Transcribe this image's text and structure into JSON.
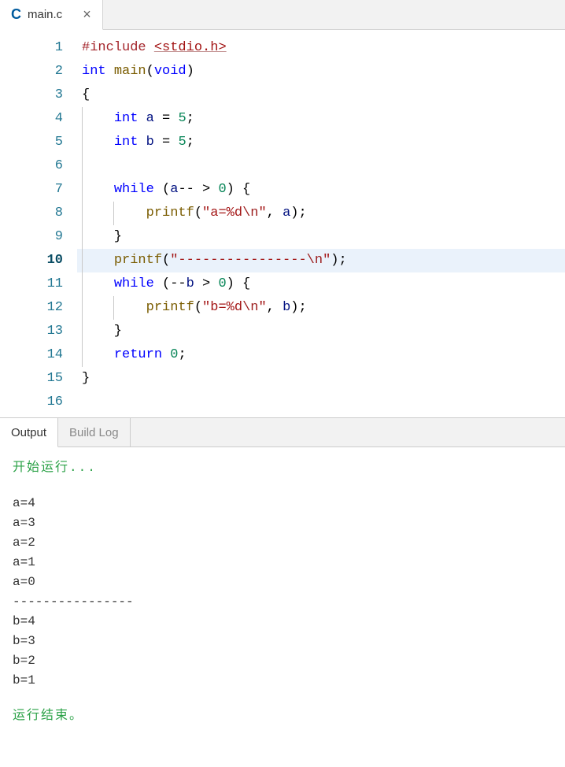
{
  "file_tab": {
    "icon": "C",
    "filename": "main.c",
    "close": "×"
  },
  "editor": {
    "current_line": 10,
    "lines": [
      {
        "num": 1,
        "tokens": [
          [
            "pp",
            "#include "
          ],
          [
            "inc",
            "<stdio.h>"
          ]
        ]
      },
      {
        "num": 2,
        "tokens": [
          [
            "type",
            "int"
          ],
          [
            "punct",
            " "
          ],
          [
            "fn",
            "main"
          ],
          [
            "punct",
            "("
          ],
          [
            "type",
            "void"
          ],
          [
            "punct",
            ")"
          ]
        ]
      },
      {
        "num": 3,
        "tokens": [
          [
            "punct",
            "{"
          ]
        ]
      },
      {
        "num": 4,
        "indent": 1,
        "tokens": [
          [
            "punct",
            "    "
          ],
          [
            "type",
            "int"
          ],
          [
            "punct",
            " "
          ],
          [
            "var",
            "a"
          ],
          [
            "punct",
            " "
          ],
          [
            "op",
            "="
          ],
          [
            "punct",
            " "
          ],
          [
            "num",
            "5"
          ],
          [
            "punct",
            ";"
          ]
        ]
      },
      {
        "num": 5,
        "indent": 1,
        "tokens": [
          [
            "punct",
            "    "
          ],
          [
            "type",
            "int"
          ],
          [
            "punct",
            " "
          ],
          [
            "var",
            "b"
          ],
          [
            "punct",
            " "
          ],
          [
            "op",
            "="
          ],
          [
            "punct",
            " "
          ],
          [
            "num",
            "5"
          ],
          [
            "punct",
            ";"
          ]
        ]
      },
      {
        "num": 6,
        "indent": 1,
        "tokens": []
      },
      {
        "num": 7,
        "indent": 1,
        "tokens": [
          [
            "punct",
            "    "
          ],
          [
            "kw",
            "while"
          ],
          [
            "punct",
            " ("
          ],
          [
            "var",
            "a"
          ],
          [
            "op",
            "--"
          ],
          [
            "punct",
            " "
          ],
          [
            "op",
            ">"
          ],
          [
            "punct",
            " "
          ],
          [
            "num",
            "0"
          ],
          [
            "punct",
            ") {"
          ]
        ]
      },
      {
        "num": 8,
        "indent": 2,
        "tokens": [
          [
            "punct",
            "        "
          ],
          [
            "fn",
            "printf"
          ],
          [
            "punct",
            "("
          ],
          [
            "str",
            "\"a=%d"
          ],
          [
            "esc",
            "\\n"
          ],
          [
            "str",
            "\""
          ],
          [
            "punct",
            ", "
          ],
          [
            "var",
            "a"
          ],
          [
            "punct",
            ");"
          ]
        ]
      },
      {
        "num": 9,
        "indent": 1,
        "tokens": [
          [
            "punct",
            "    }"
          ]
        ]
      },
      {
        "num": 10,
        "indent": 1,
        "tokens": [
          [
            "punct",
            "    "
          ],
          [
            "fn",
            "printf"
          ],
          [
            "punct",
            "("
          ],
          [
            "str",
            "\"----------------"
          ],
          [
            "esc",
            "\\n"
          ],
          [
            "str",
            "\""
          ],
          [
            "punct",
            ");"
          ]
        ]
      },
      {
        "num": 11,
        "indent": 1,
        "tokens": [
          [
            "punct",
            "    "
          ],
          [
            "kw",
            "while"
          ],
          [
            "punct",
            " ("
          ],
          [
            "op",
            "--"
          ],
          [
            "var",
            "b"
          ],
          [
            "punct",
            " "
          ],
          [
            "op",
            ">"
          ],
          [
            "punct",
            " "
          ],
          [
            "num",
            "0"
          ],
          [
            "punct",
            ") {"
          ]
        ]
      },
      {
        "num": 12,
        "indent": 2,
        "tokens": [
          [
            "punct",
            "        "
          ],
          [
            "fn",
            "printf"
          ],
          [
            "punct",
            "("
          ],
          [
            "str",
            "\"b=%d"
          ],
          [
            "esc",
            "\\n"
          ],
          [
            "str",
            "\""
          ],
          [
            "punct",
            ", "
          ],
          [
            "var",
            "b"
          ],
          [
            "punct",
            ");"
          ]
        ]
      },
      {
        "num": 13,
        "indent": 1,
        "tokens": [
          [
            "punct",
            "    }"
          ]
        ]
      },
      {
        "num": 14,
        "indent": 1,
        "tokens": [
          [
            "punct",
            "    "
          ],
          [
            "kw",
            "return"
          ],
          [
            "punct",
            " "
          ],
          [
            "num",
            "0"
          ],
          [
            "punct",
            ";"
          ]
        ]
      },
      {
        "num": 15,
        "tokens": [
          [
            "punct",
            "}"
          ]
        ]
      },
      {
        "num": 16,
        "tokens": []
      }
    ]
  },
  "bottom_tabs": {
    "output": "Output",
    "build_log": "Build Log",
    "active": "output"
  },
  "output": {
    "start": "开始运行...",
    "lines": [
      "a=4",
      "a=3",
      "a=2",
      "a=1",
      "a=0",
      "----------------",
      "b=4",
      "b=3",
      "b=2",
      "b=1"
    ],
    "end": "运行结束。"
  }
}
